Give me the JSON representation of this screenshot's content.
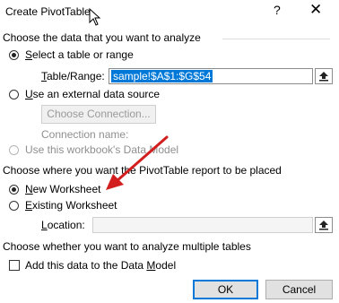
{
  "window": {
    "title": "Create PivotTable",
    "help": "?",
    "close": "✕"
  },
  "analyze": {
    "heading": "Choose the data that you want to analyze",
    "select_table": {
      "prefix": "",
      "hotkey": "S",
      "rest": "elect a table or range",
      "selected": true
    },
    "table_range_label": {
      "prefix": "",
      "hotkey": "T",
      "rest": "able/Range:"
    },
    "table_range_value": "sample!$A$1:$G$54",
    "external": {
      "prefix": "",
      "hotkey": "U",
      "rest": "se an external data source",
      "selected": false
    },
    "choose_connection": "Choose Connection...",
    "connection_name": "Connection name:",
    "data_model": {
      "label": "Use this workbook's Data Model",
      "enabled": false
    }
  },
  "placement": {
    "heading": "Choose where you want the PivotTable report to be placed",
    "new_worksheet": {
      "prefix": "",
      "hotkey": "N",
      "rest": "ew Worksheet",
      "selected": true
    },
    "existing_worksheet": {
      "prefix": "",
      "hotkey": "E",
      "rest": "xisting Worksheet",
      "selected": false
    },
    "location_label": {
      "prefix": "",
      "hotkey": "L",
      "rest": "ocation:"
    },
    "location_value": ""
  },
  "multiple": {
    "heading": "Choose whether you want to analyze multiple tables",
    "add_data_model": {
      "prefix": "Add this data to the Data ",
      "hotkey": "M",
      "rest": "odel",
      "checked": false
    }
  },
  "buttons": {
    "ok": "OK",
    "cancel": "Cancel"
  },
  "annotation": {
    "arrow_color": "#d21e1e"
  },
  "colors": {
    "selection_highlight": "#0078d7",
    "default_button_border": "#0078d7"
  },
  "icons": {
    "range_picker": "range-picker-icon",
    "cursor": "mouse-pointer-icon"
  }
}
